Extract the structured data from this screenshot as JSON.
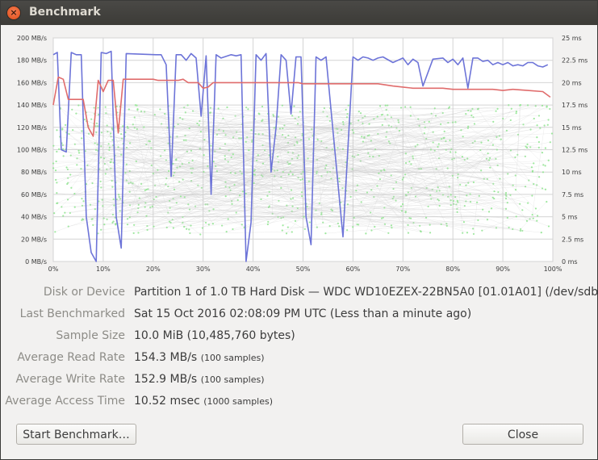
{
  "window": {
    "title": "Benchmark"
  },
  "chart_data": {
    "type": "line",
    "left_axis": {
      "unit": "MB/s",
      "ticks": [
        "0 MB/s",
        "20 MB/s",
        "40 MB/s",
        "60 MB/s",
        "80 MB/s",
        "100 MB/s",
        "120 MB/s",
        "140 MB/s",
        "160 MB/s",
        "180 MB/s",
        "200 MB/s"
      ],
      "range": [
        0,
        200
      ]
    },
    "right_axis": {
      "unit": "ms",
      "ticks": [
        "0 ms",
        "2.5 ms",
        "5 ms",
        "7.5 ms",
        "10 ms",
        "12.5 ms",
        "15 ms",
        "17.5 ms",
        "20 ms",
        "22.5 ms",
        "25 ms"
      ],
      "range": [
        0,
        25
      ]
    },
    "x_axis": {
      "ticks": [
        "0%",
        "10%",
        "20%",
        "30%",
        "40%",
        "50%",
        "60%",
        "70%",
        "80%",
        "90%",
        "100%"
      ],
      "range": [
        0,
        100
      ]
    },
    "grid": true,
    "series": [
      {
        "color": "#6d74d8",
        "x": [
          0,
          0.8,
          1.6,
          2.6,
          3.6,
          4.6,
          5.6,
          6.6,
          7.6,
          8.6,
          9.6,
          10.6,
          11.6,
          12.6,
          13.6,
          14.6,
          20.6,
          21.6,
          22.6,
          23.6,
          24.6,
          25.6,
          26.6,
          27.6,
          28.6,
          29.6,
          30.6,
          31.6,
          32.6,
          33.6,
          35.6,
          36.6,
          37.6,
          38.6,
          39.6,
          40.6,
          41.6,
          42.6,
          43.6,
          44.6,
          45.6,
          46.6,
          47.6,
          48.6,
          49.6,
          50.6,
          51.6,
          52.6,
          53.6,
          54.6,
          58,
          60,
          61,
          62,
          63,
          64,
          65,
          66,
          68,
          69,
          70,
          71,
          72,
          73,
          74,
          76,
          78,
          79,
          80,
          81,
          82,
          83,
          84,
          85,
          86,
          87,
          88,
          89,
          90,
          91,
          92,
          93,
          94,
          95,
          96,
          97,
          98,
          99
        ],
        "y": [
          185,
          187,
          100,
          98,
          187,
          185,
          185,
          40,
          8,
          0,
          187,
          186,
          188,
          40,
          12,
          186,
          185,
          185,
          176,
          76,
          185,
          185,
          180,
          186,
          182,
          130,
          184,
          60,
          185,
          182,
          185,
          184,
          185,
          0,
          35,
          185,
          180,
          186,
          80,
          120,
          185,
          180,
          132,
          183,
          183,
          40,
          15,
          183,
          180,
          183,
          22,
          183,
          180,
          183,
          182,
          180,
          182,
          183,
          178,
          180,
          182,
          176,
          181,
          178,
          157,
          181,
          182,
          178,
          181,
          176,
          182,
          155,
          182,
          182,
          179,
          180,
          176,
          178,
          176,
          178,
          175,
          176,
          175,
          178,
          178,
          175,
          174,
          176
        ],
        "scale": "left"
      },
      {
        "color": "#e06c6c",
        "x": [
          0,
          1,
          2,
          3,
          4,
          6,
          7,
          8,
          9,
          10,
          11,
          12,
          13,
          14,
          20,
          21,
          22,
          23,
          25,
          26,
          27,
          28,
          29,
          30,
          31,
          32,
          33,
          36,
          37,
          38,
          39,
          40,
          41,
          42,
          43,
          44,
          45,
          46,
          47,
          48,
          49,
          50,
          51,
          52,
          53,
          55,
          60,
          65,
          68,
          70,
          72,
          75,
          78,
          80,
          82,
          85,
          88,
          90,
          92,
          95,
          98,
          99.5
        ],
        "y": [
          140,
          165,
          163,
          145,
          145,
          145,
          120,
          112,
          162,
          152,
          162,
          162,
          115,
          163,
          163,
          162,
          162,
          162,
          162,
          163,
          160,
          160,
          160,
          155,
          156,
          160,
          160,
          160,
          160,
          160,
          160,
          160,
          160,
          160,
          160,
          160,
          160,
          160,
          160,
          160,
          160,
          159,
          159,
          159,
          159,
          159,
          159,
          159,
          157,
          156,
          155,
          155,
          155,
          154,
          154,
          154,
          154,
          153,
          154,
          153,
          152,
          147
        ],
        "scale": "left"
      }
    ]
  },
  "info": {
    "rows": [
      {
        "label": "Disk or Device",
        "value": "Partition 1 of 1.0 TB Hard Disk — WDC WD10EZEX-22BN5A0 [01.01A01] (/dev/sdb1)",
        "note": ""
      },
      {
        "label": "Last Benchmarked",
        "value": "Sat 15 Oct 2016 02:08:09 PM UTC (Less than a minute ago)",
        "note": ""
      },
      {
        "label": "Sample Size",
        "value": "10.0 MiB (10,485,760 bytes)",
        "note": ""
      },
      {
        "label": "Average Read Rate",
        "value": "154.3 MB/s",
        "note": "(100 samples)"
      },
      {
        "label": "Average Write Rate",
        "value": "152.9 MB/s",
        "note": "(100 samples)"
      },
      {
        "label": "Average Access Time",
        "value": "10.52 msec",
        "note": "(1000 samples)"
      }
    ]
  },
  "buttons": {
    "start": "Start Benchmark…",
    "close": "Close"
  }
}
